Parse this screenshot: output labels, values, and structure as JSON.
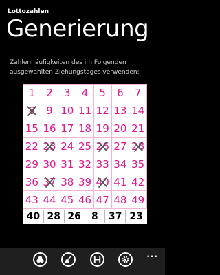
{
  "header": {
    "app_title": "Lottozahlen",
    "page_title": "Generierung"
  },
  "instructions": "Zahlenhäufigkeiten des im Folgenden ausgewählten Ziehungstages verwenden:",
  "grid": {
    "numbers": [
      1,
      2,
      3,
      4,
      5,
      6,
      7,
      8,
      9,
      10,
      11,
      12,
      13,
      14,
      15,
      16,
      17,
      18,
      19,
      20,
      21,
      22,
      23,
      24,
      25,
      26,
      27,
      28,
      29,
      30,
      31,
      32,
      33,
      34,
      35,
      36,
      37,
      38,
      39,
      40,
      41,
      42,
      43,
      44,
      45,
      46,
      47,
      48,
      49
    ],
    "crossed": [
      8,
      23,
      26,
      28,
      37,
      40
    ]
  },
  "results": [
    "40",
    "28",
    "26",
    "8",
    "37",
    "23"
  ],
  "app_bar": {
    "buttons": [
      "balls-icon",
      "broom-icon",
      "save-icon",
      "settings-icon"
    ],
    "more": "..."
  },
  "colors": {
    "number": "#e0168c",
    "grid_line": "#f4b3d4",
    "cross": "#555555"
  }
}
